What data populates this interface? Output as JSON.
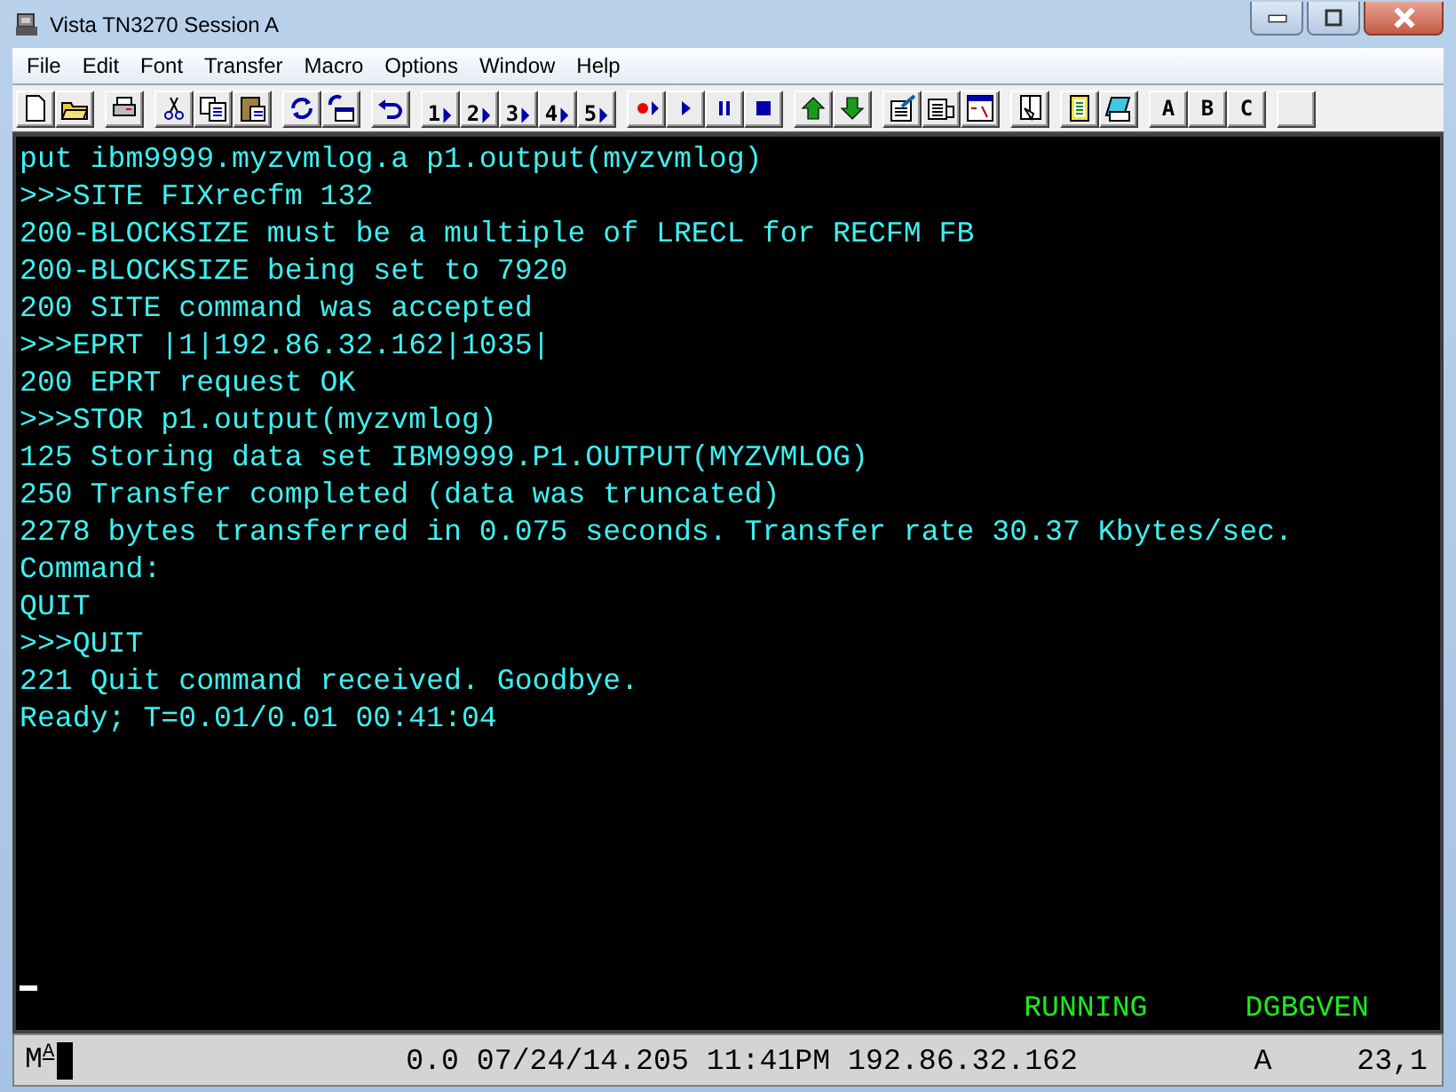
{
  "window": {
    "title": "Vista TN3270 Session A"
  },
  "menu": [
    {
      "label": "File"
    },
    {
      "label": "Edit"
    },
    {
      "label": "Font"
    },
    {
      "label": "Transfer"
    },
    {
      "label": "Macro"
    },
    {
      "label": "Options"
    },
    {
      "label": "Window"
    },
    {
      "label": "Help"
    }
  ],
  "toolbar": {
    "macro_buttons": [
      "1",
      "2",
      "3",
      "4",
      "5"
    ],
    "session_buttons": [
      "A",
      "B",
      "C"
    ]
  },
  "terminal": {
    "lines": [
      "put ibm9999.myzvmlog.a p1.output(myzvmlog)",
      ">>>SITE FIXrecfm 132",
      "200-BLOCKSIZE must be a multiple of LRECL for RECFM FB",
      "200-BLOCKSIZE being set to 7920",
      "200 SITE command was accepted",
      ">>>EPRT |1|192.86.32.162|1035|",
      "200 EPRT request OK",
      ">>>STOR p1.output(myzvmlog)",
      "125 Storing data set IBM9999.P1.OUTPUT(MYZVMLOG)",
      "250 Transfer completed (data was truncated)",
      "2278 bytes transferred in 0.075 seconds. Transfer rate 30.37 Kbytes/sec.",
      "Command:",
      "QUIT",
      ">>>QUIT",
      "221 Quit command received. Goodbye.",
      "Ready; T=0.01/0.01 00:41:04"
    ],
    "status": [
      "RUNNING",
      "DGBGVEN"
    ]
  },
  "status_bar": {
    "mode": "M",
    "mode_sub": "A",
    "info": "0.0 07/24/14.205 11:41PM 192.86.32.162",
    "field": "A",
    "cursor": "23,1"
  }
}
